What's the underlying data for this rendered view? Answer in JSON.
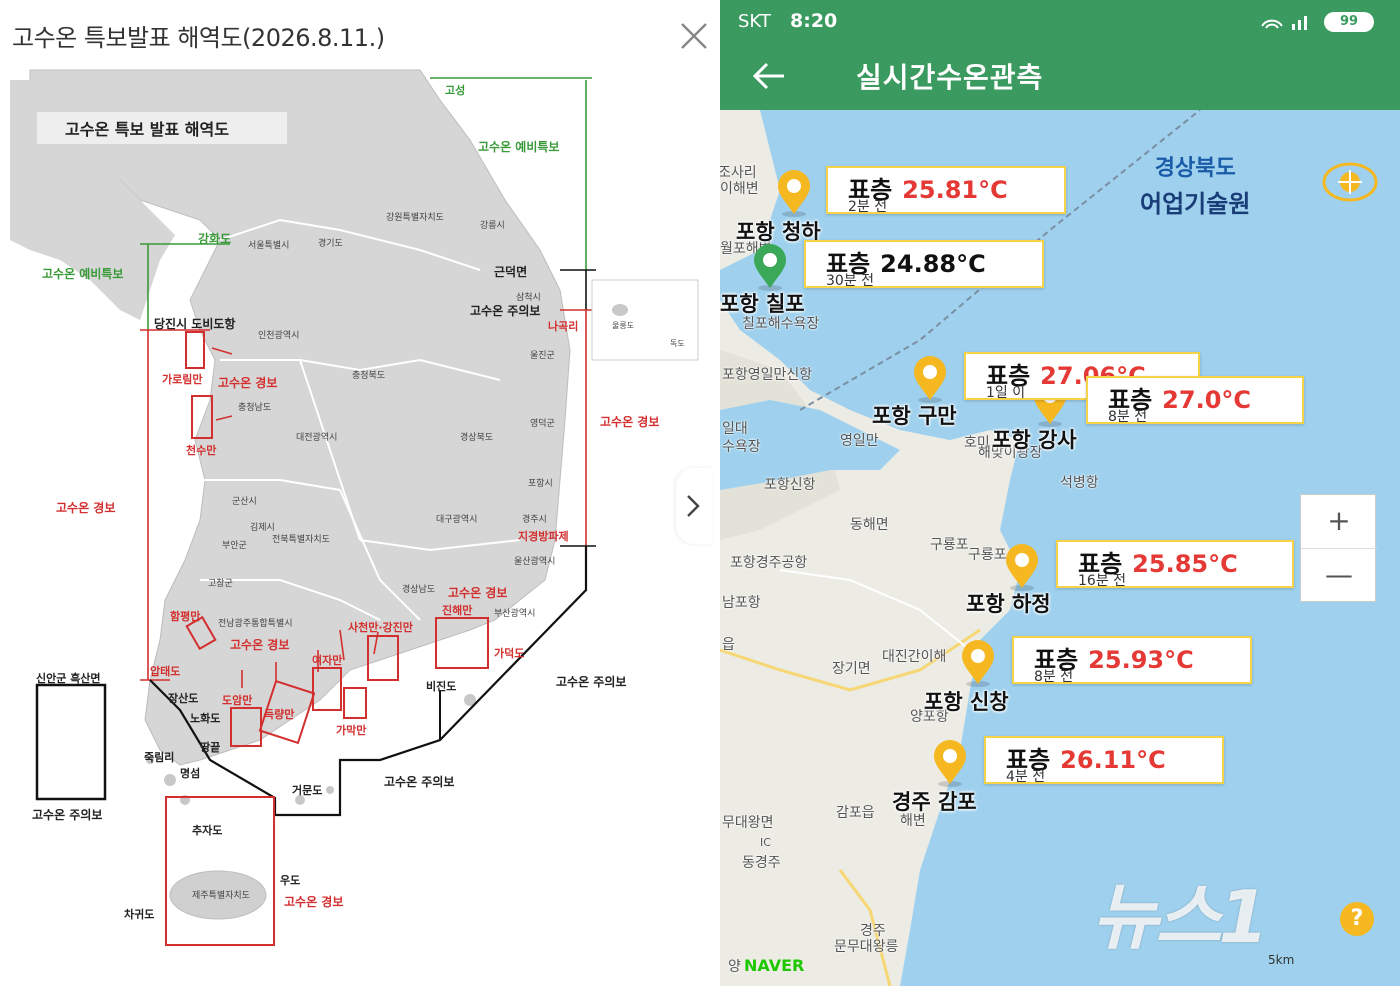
{
  "left_panel": {
    "title": "고수온 특보발표 해역도(2026.8.11.)",
    "map": {
      "inner_title": "고수온 특보 발표 해역도",
      "region_labels": {
        "goseong": "고성",
        "ganghwado": "강화도",
        "geundeokmyeon": "근덕면",
        "dangjin": "당진시 도비도항",
        "nagok": "나곡리",
        "jigyeong": "지경방파제",
        "hwangpyeong": "함평만",
        "aptae": "압태도",
        "sinan": "신안군 흑산면",
        "jangsan": "장산도",
        "nohwa": "노화도",
        "ttangkkeut": "땅끝",
        "jurim": "죽림리",
        "myeongseom": "명섬",
        "geomundo": "거문도",
        "chujado": "추자도",
        "udo": "우도",
        "chagwido": "차귀도",
        "bijindo": "비진도",
        "gadeokdo": "가덕도",
        "ulleungdo": "울릉도",
        "dokdo": "독도",
        "garim": "가로림만",
        "cheonsu": "천수만",
        "doam": "도암만",
        "deungnyang": "득량만",
        "yeoja": "여자만",
        "gamak": "가막만",
        "sacheon": "사천만·강진만",
        "jinhae": "진해만",
        "jeju": "제주특별자치도"
      },
      "zone_labels": {
        "east_yebi": "고수온 예비특보",
        "west_yebi": "고수온 예비특보",
        "east_jueui": "고수온 주의보",
        "east_gyeongbo": "고수온 경보",
        "west_gyeongbo": "고수온 경보",
        "bay_gyeongbo_1": "고수온 경보",
        "bay_gyeongbo_2": "고수온 경보",
        "bay_gyeongbo_3": "고수온 경보",
        "south_jueui_1": "고수온 주의보",
        "south_jueui_2": "고수온 주의보",
        "sinan_jueui": "고수온 주의보",
        "jeju_gyeongbo": "고수온 경보"
      },
      "province_labels": {
        "gangwon": "강원특별자치도",
        "gangneung": "강릉시",
        "samcheok": "삼척시",
        "uljin": "울진군",
        "yeongdeok": "영덕군",
        "pohang": "포항시",
        "gyeongju": "경주시",
        "ulsan": "울산광역시",
        "busan": "부산광역시",
        "gyeongnam": "경상남도",
        "gyeongbuk": "경상북도",
        "daegu": "대구광역시",
        "chungbuk": "충청북도",
        "chungnam": "충청남도",
        "daejeon": "대전광역시",
        "gyeonggi": "경기도",
        "seoul": "서울특별시",
        "incheon": "인천광역시",
        "gunsan": "군산시",
        "gimje": "김제시",
        "buan": "부안군",
        "jeonbuk": "전북특별자치도",
        "gochang": "고창군",
        "jeonnam": "전남광주통합특별시"
      }
    },
    "colors": {
      "warning_red": "#d32f2f",
      "advisory_black": "#111111",
      "pre_green": "#3a9a3a",
      "land": "#d7d7d7"
    }
  },
  "right_panel": {
    "status_bar": {
      "carrier": "SKT",
      "time": "8:20",
      "battery": "99"
    },
    "app_bar": {
      "title": "실시간수온관측"
    },
    "brand": {
      "line1": "경상북도",
      "line2": "어업기술원"
    },
    "stations": [
      {
        "name": "포항 청하",
        "layer": "표층",
        "temp": "25.81°C",
        "ago": "2분 전"
      },
      {
        "name": "포항 칠포",
        "layer": "표층",
        "temp": "24.88°C",
        "ago": "30분 전"
      },
      {
        "name": "포항 구만",
        "layer": "표층",
        "temp": "27.06°C",
        "ago": "1일 이"
      },
      {
        "name": "포항 강사",
        "layer": "표층",
        "temp": "27.0°C",
        "ago": "8분 전"
      },
      {
        "name": "포항 하정",
        "layer": "표층",
        "temp": "25.85°C",
        "ago": "16분 전"
      },
      {
        "name": "포항 신창",
        "layer": "표층",
        "temp": "25.93°C",
        "ago": "8분 전"
      },
      {
        "name": "경주 감포",
        "layer": "표층",
        "temp": "26.11°C",
        "ago": "4분 전"
      }
    ],
    "places": {
      "sari": "조사리",
      "sari2": "이해변",
      "wolpo": "월포해변",
      "chilpo_beach": "칠포해수욕장",
      "yeongilman": "포항영일만신항",
      "ildae": "일대",
      "bathing": "수욕장",
      "yeongilman2": "영일만",
      "homi": "호미",
      "haemaji": "해맞이광장",
      "seokbyeong": "석병항",
      "pohang_port": "포항신항",
      "donghae": "동해면",
      "guryongpo": "구룡포",
      "guryong2": "구룡포",
      "airport": "포항경주공항",
      "nampo": "남포항",
      "eup": "읍",
      "daejingan": "대진간이해",
      "janggi": "장기면",
      "yangpo": "양포항",
      "gampo_eup": "감포읍",
      "haebyeon": "해변",
      "mudae": "무대왕면",
      "ic": "IC",
      "donggyeongju": "동경주",
      "gyeongju_tomb": "경주",
      "munmu": "문무대왕릉",
      "yang": "양"
    },
    "zoom": {
      "in": "+",
      "out": "—"
    },
    "map_credit": "NAVER",
    "scale": "5km",
    "watermark": "뉴스1",
    "help": "?",
    "colors": {
      "app_green": "#3a9a5f",
      "temp_red": "#e53935",
      "pin_yellow": "#f5b820",
      "pin_green": "#3aa858",
      "sea": "#9fd1ee"
    }
  }
}
